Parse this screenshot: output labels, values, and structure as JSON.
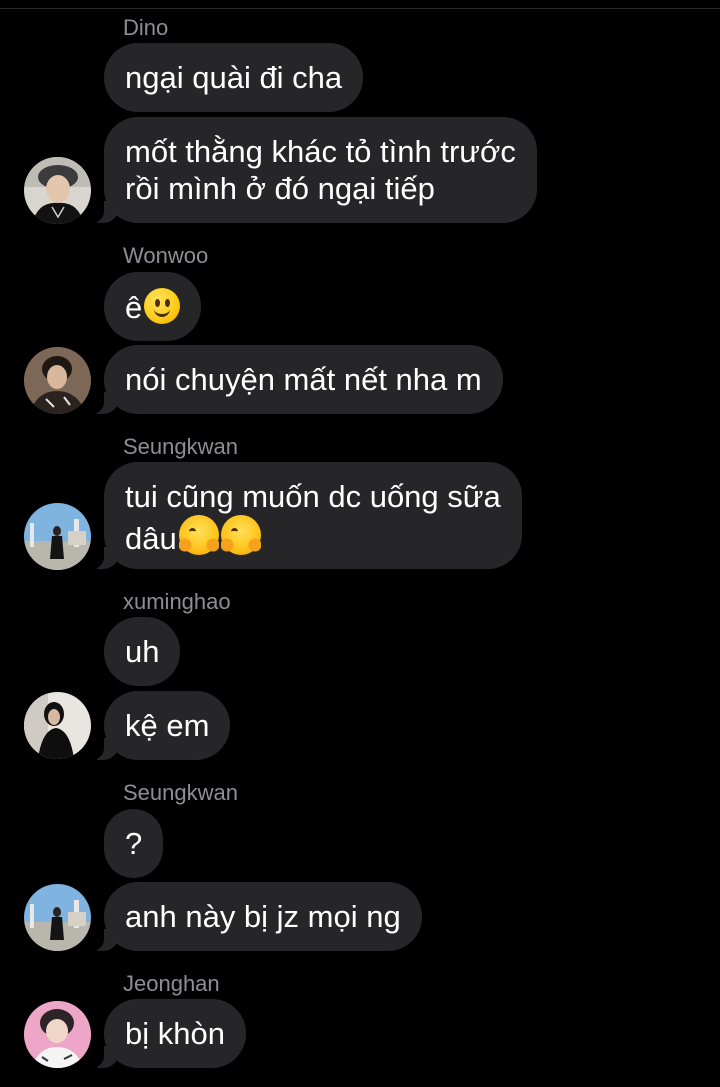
{
  "messages": [
    {
      "sender": "Dino",
      "bubbles": [
        "ngại quài đi cha",
        "mốt thằng khác tỏ tình trước",
        "rồi mình ở đó ngại tiếp"
      ]
    },
    {
      "sender": "Wonwoo",
      "bubbles": [
        "ê",
        "nói chuyện mất nết nha m"
      ]
    },
    {
      "sender": "Seungkwan",
      "bubbles": [
        "tui cũng muốn dc uống sữa",
        "dâu"
      ]
    },
    {
      "sender": "xuminghao",
      "bubbles": [
        "uh",
        "kệ em"
      ]
    },
    {
      "sender": "Seungkwan",
      "bubbles": [
        "?",
        "anh này bị jz mọi ng"
      ]
    },
    {
      "sender": "Jeonghan",
      "bubbles": [
        "bị khòn"
      ]
    }
  ],
  "emojis": {
    "wonwoo_reaction": "slightly-smiling-face-icon",
    "seungkwan_reaction": "hugging-face-icon"
  },
  "colors": {
    "background": "#000000",
    "bubble": "#262628",
    "sender_name": "#8e8e93",
    "text": "#ffffff"
  }
}
